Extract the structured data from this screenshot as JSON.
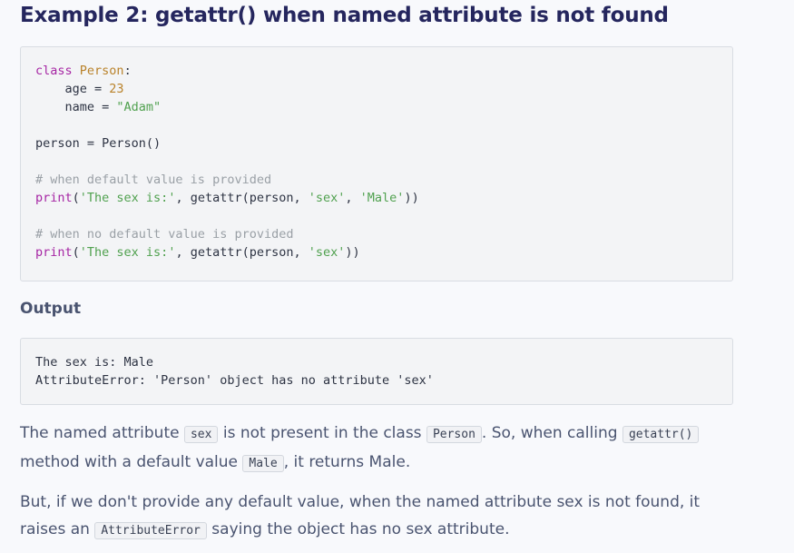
{
  "heading": "Example 2: getattr() when named attribute is not found",
  "code_example": [
    [
      {
        "t": "class",
        "c": "kw"
      },
      {
        "t": " "
      },
      {
        "t": "Person",
        "c": "cls"
      },
      {
        "t": ":"
      }
    ],
    [
      {
        "t": "    age = "
      },
      {
        "t": "23",
        "c": "num"
      }
    ],
    [
      {
        "t": "    name = "
      },
      {
        "t": "\"Adam\"",
        "c": "str"
      }
    ],
    [],
    [
      {
        "t": "person = Person()"
      }
    ],
    [],
    [
      {
        "t": "# when default value is provided",
        "c": "cm"
      }
    ],
    [
      {
        "t": "print",
        "c": "fn"
      },
      {
        "t": "("
      },
      {
        "t": "'The sex is:'",
        "c": "str"
      },
      {
        "t": ", getattr(person, "
      },
      {
        "t": "'sex'",
        "c": "str"
      },
      {
        "t": ", "
      },
      {
        "t": "'Male'",
        "c": "str"
      },
      {
        "t": "))"
      }
    ],
    [],
    [
      {
        "t": "# when no default value is provided",
        "c": "cm"
      }
    ],
    [
      {
        "t": "print",
        "c": "fn"
      },
      {
        "t": "("
      },
      {
        "t": "'The sex is:'",
        "c": "str"
      },
      {
        "t": ", getattr(person, "
      },
      {
        "t": "'sex'",
        "c": "str"
      },
      {
        "t": "))"
      }
    ]
  ],
  "output_heading": "Output",
  "output_lines": [
    "The sex is: Male",
    "AttributeError: 'Person' object has no attribute 'sex'"
  ],
  "para1": {
    "t1": "The named attribute ",
    "c1": "sex",
    "t2": " is not present in the class ",
    "c2": "Person",
    "t3": ". So, when calling ",
    "c3": "getattr()",
    "t4": " method with a default value ",
    "c4": "Male",
    "t5": ", it returns Male."
  },
  "para2": {
    "t1": "But, if we don't provide any default value, when the named attribute sex is not found, it raises an ",
    "c1": "AttributeError",
    "t2": " saying the object has no sex attribute."
  }
}
